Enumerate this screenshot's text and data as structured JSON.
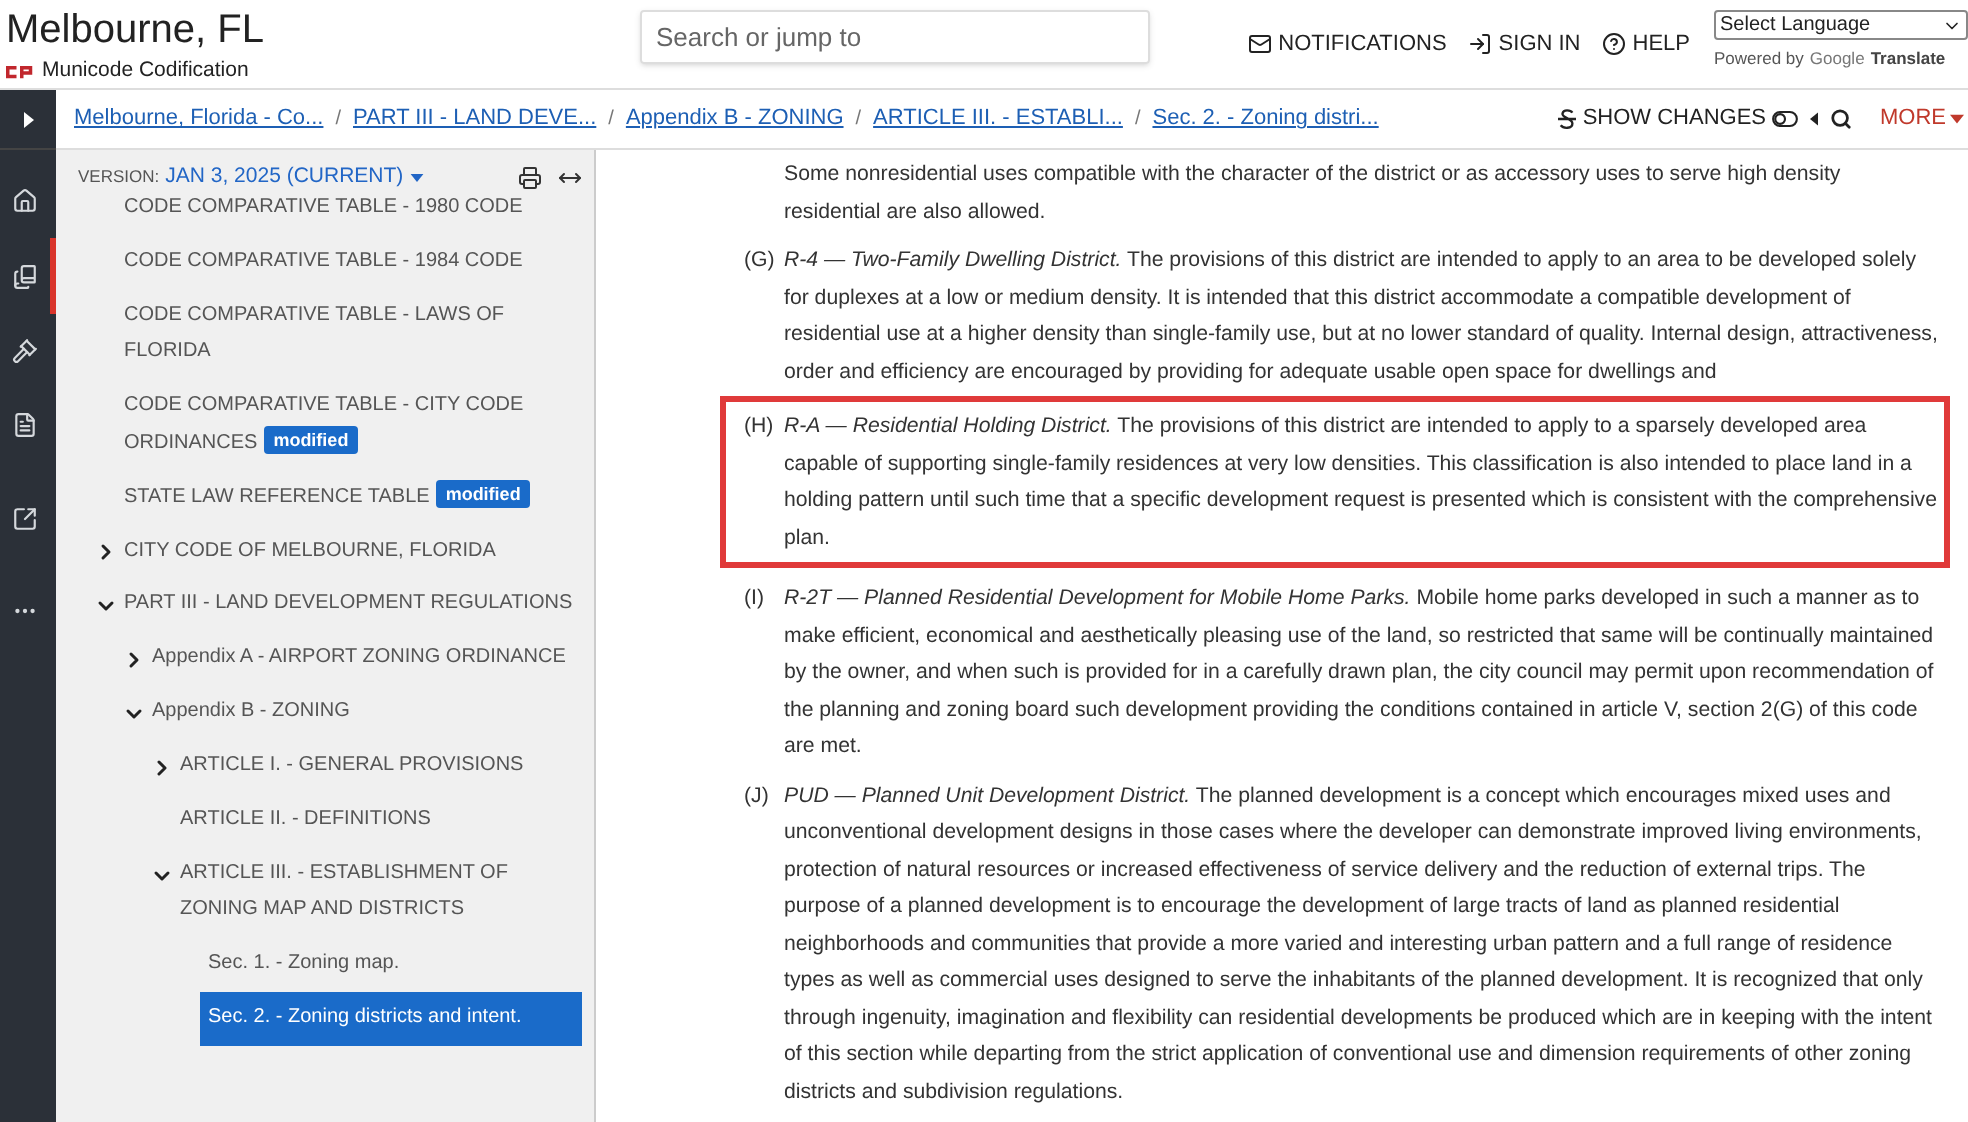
{
  "header": {
    "site_title": "Melbourne, FL",
    "logo_text": "Municode Codification",
    "search": {
      "placeholder": "Search or jump to"
    },
    "nav": [
      {
        "kind": "notifications",
        "label": "NOTIFICATIONS"
      },
      {
        "kind": "signin",
        "label": "SIGN IN"
      },
      {
        "kind": "help",
        "label": "HELP"
      }
    ],
    "language_select": "Select Language",
    "powered_by": "Powered by",
    "google": "Google",
    "translate": "Translate"
  },
  "breadcrumbs": [
    {
      "label": "Melbourne, Florida - Co..."
    },
    {
      "separator": "/",
      "label": "PART III - LAND DEVE..."
    },
    {
      "separator": "/",
      "label": "Appendix B - ZONING"
    },
    {
      "separator": "/",
      "label": "ARTICLE III. - ESTABLI..."
    },
    {
      "separator": "/",
      "label": "Sec. 2. - Zoning distri..."
    }
  ],
  "toolbar": {
    "show_changes": "SHOW CHANGES",
    "more": "MORE"
  },
  "rail": [
    {
      "kind": "home",
      "selected": false
    },
    {
      "kind": "books",
      "selected": true
    },
    {
      "kind": "gavel",
      "selected": false
    },
    {
      "kind": "document",
      "selected": false
    },
    {
      "kind": "external",
      "selected": false
    },
    {
      "kind": "more",
      "selected": false
    }
  ],
  "sidebar": {
    "version_label": "VERSION:",
    "version": "JAN 3, 2025 (CURRENT)",
    "items": [
      {
        "label": "CODE COMPARATIVE TABLE - 1980 CODE",
        "selected": false
      },
      {
        "label": "CODE COMPARATIVE TABLE - 1984 CODE",
        "selected": false
      },
      {
        "label": "CODE COMPARATIVE TABLE - LAWS OF FLORIDA",
        "selected": false
      },
      {
        "label": "CODE COMPARATIVE TABLE - CITY CODE ORDINANCES",
        "badge": "modified",
        "selected": false
      },
      {
        "label": "STATE LAW REFERENCE TABLE",
        "badge": "modified",
        "selected": false
      },
      {
        "label": "CITY CODE OF MELBOURNE, FLORIDA",
        "expanded": false,
        "selected": false
      },
      {
        "label": "PART III - LAND DEVELOPMENT REGULATIONS",
        "expanded": true,
        "selected": false,
        "children": [
          {
            "label": "Appendix A - AIRPORT ZONING ORDINANCE",
            "expanded": false,
            "selected": false
          },
          {
            "label": "Appendix B - ZONING",
            "expanded": true,
            "selected": false,
            "children": [
              {
                "label": "ARTICLE I. - GENERAL PROVISIONS",
                "expanded": false,
                "selected": false
              },
              {
                "label": "ARTICLE II. - DEFINITIONS",
                "selected": false
              },
              {
                "label": "ARTICLE III. - ESTABLISHMENT OF ZONING MAP AND DISTRICTS",
                "expanded": true,
                "selected": false,
                "children": [
                  {
                    "label": "Sec. 1. - Zoning map.",
                    "selected": false
                  },
                  {
                    "label": "Sec. 2. - Zoning districts and intent.",
                    "selected": true
                  }
                ]
              }
            ]
          }
        ]
      }
    ]
  },
  "content": {
    "paragraphs": [
      {
        "text": "Some nonresidential uses compatible with the character of the district or as accessory uses to serve high density residential are also allowed.",
        "highlighted": false
      },
      {
        "label": "(G)",
        "text": "*R-4 — Two-Family Dwelling District.* The provisions of this district are intended to apply to an area to be developed solely for duplexes at a low or medium density. It is intended that this district accommodate a compatible development of residential use at a higher density than single-family use, but at no lower standard of quality. Internal design, attractiveness, order and efficiency are encouraged by providing for adequate usable open space for dwellings and",
        "highlighted": false
      },
      {
        "label": "(H)",
        "text": "*R-A — Residential Holding District.* The provisions of this district are intended to apply to a sparsely developed area capable of supporting single-family residences at very low densities. This classification is also intended to place land in a holding pattern until such time that a specific development request is presented which is consistent with the comprehensive plan.",
        "highlighted": true
      },
      {
        "label": "(I)",
        "text": "*R-2T — Planned Residential Development for Mobile Home Parks.* Mobile home parks developed in such a manner as to make efficient, economical and aesthetically pleasing use of the land, so restricted that same will be continually maintained by the owner, and when such is provided for in a carefully drawn plan, the city council may permit upon recommendation of the planning and zoning board such development providing the conditions contained in article V, section 2(G) of this code are met.",
        "highlighted": false
      },
      {
        "label": "(J)",
        "text": "*PUD — Planned Unit Development District.* The planned development is a concept which encourages mixed uses and unconventional development designs in those cases where the developer can demonstrate improved living environments, protection of natural resources or increased effectiveness of service delivery and the reduction of external trips. The purpose of a planned development is to encourage the development of large tracts of land as planned residential neighborhoods and communities that provide a more varied and interesting urban pattern and a full range of residence types as well as commercial uses designed to serve the inhabitants of the planned development. It is recognized that only through ingenuity, imagination and flexibility can residential developments be produced which are in keeping with the intent of this section while departing from the strict application of conventional use and dimension requirements of other zoning districts and subdivision regulations.",
        "highlighted": false
      }
    ]
  }
}
